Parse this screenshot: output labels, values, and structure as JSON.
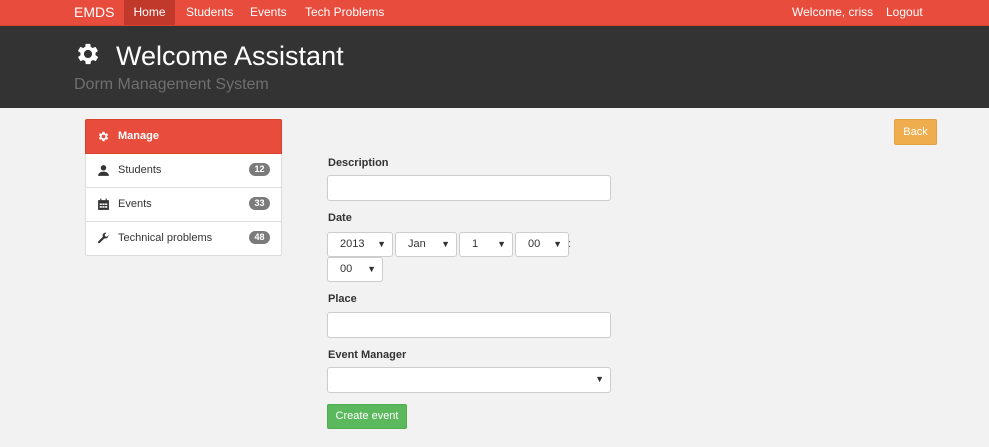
{
  "navbar": {
    "brand": "EMDS",
    "items": [
      {
        "label": "Home",
        "active": true
      },
      {
        "label": "Students"
      },
      {
        "label": "Events"
      },
      {
        "label": "Tech Problems"
      }
    ],
    "welcome": "Welcome, criss",
    "logout": "Logout",
    "color": "#e74c3c"
  },
  "header": {
    "icon": "gear-icon",
    "title": "Welcome Assistant",
    "subtitle": "Dorm Management System"
  },
  "sidebar": {
    "items": [
      {
        "label": "Manage",
        "icon": "gear-icon",
        "active": true
      },
      {
        "label": "Students",
        "icon": "user-icon",
        "count": "12"
      },
      {
        "label": "Events",
        "icon": "calendar-icon",
        "count": "33"
      },
      {
        "label": "Technical problems",
        "icon": "wrench-icon",
        "count": "48"
      }
    ]
  },
  "form": {
    "description_label": "Description",
    "description_value": "",
    "date_label": "Date",
    "date": {
      "year": "2013",
      "month": "Jan",
      "day": "1",
      "hour": "00",
      "separator": ":",
      "minute": "00"
    },
    "place_label": "Place",
    "place_value": "",
    "manager_label": "Event Manager",
    "manager_value": "",
    "submit_label": "Create event"
  },
  "back_label": "Back",
  "colors": {
    "primary": "#e74c3c",
    "header_bg": "#333333",
    "success": "#5cb85c",
    "warning": "#f0ad4e"
  }
}
